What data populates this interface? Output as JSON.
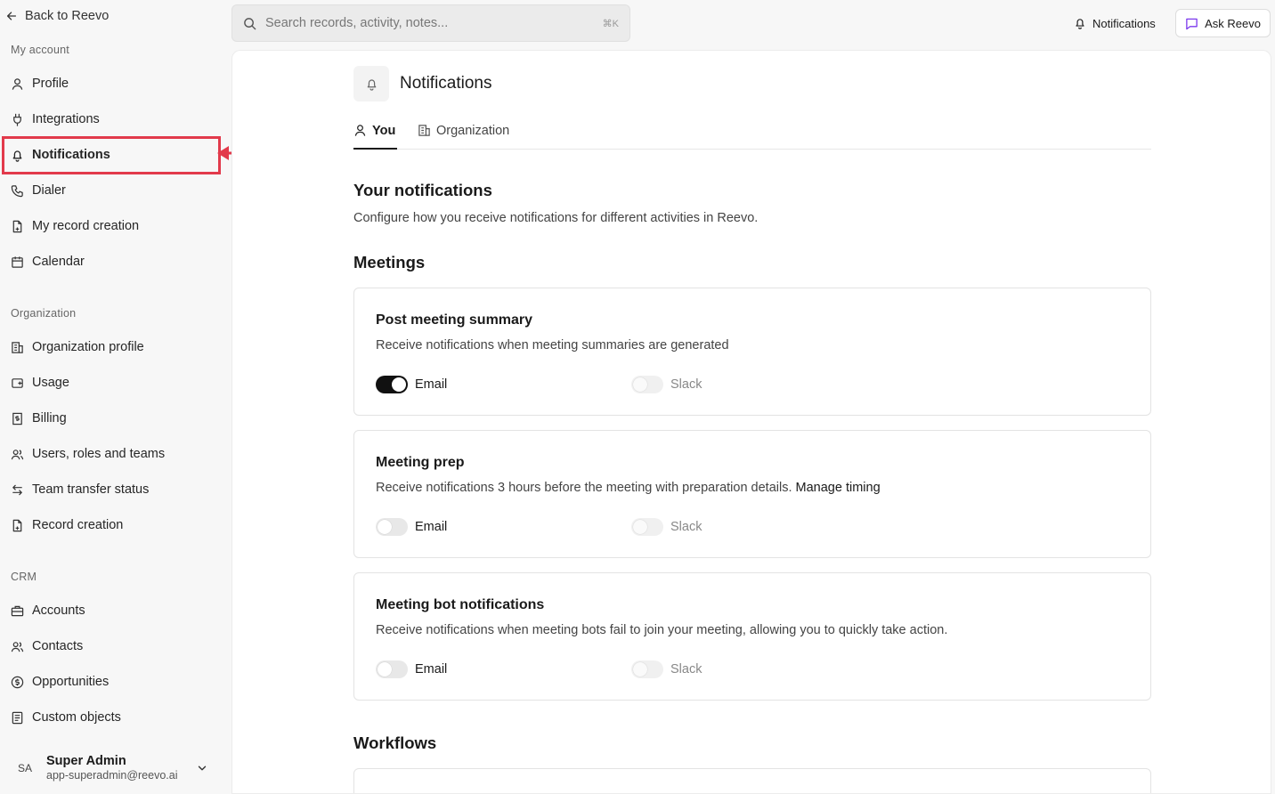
{
  "sidebar": {
    "back_label": "Back to Reevo",
    "my_account": {
      "label": "My account",
      "items": [
        {
          "label": "Profile",
          "icon": "user-icon"
        },
        {
          "label": "Integrations",
          "icon": "plug-icon"
        },
        {
          "label": "Notifications",
          "icon": "bell-icon",
          "active": true
        },
        {
          "label": "Dialer",
          "icon": "phone-icon"
        },
        {
          "label": "My record creation",
          "icon": "file-icon"
        },
        {
          "label": "Calendar",
          "icon": "calendar-icon"
        }
      ]
    },
    "organization": {
      "label": "Organization",
      "items": [
        {
          "label": "Organization profile",
          "icon": "building-icon"
        },
        {
          "label": "Usage",
          "icon": "usage-icon"
        },
        {
          "label": "Billing",
          "icon": "receipt-icon"
        },
        {
          "label": "Users, roles and teams",
          "icon": "users-icon"
        },
        {
          "label": "Team transfer status",
          "icon": "transfer-icon"
        },
        {
          "label": "Record creation",
          "icon": "file-icon"
        }
      ]
    },
    "crm": {
      "label": "CRM",
      "items": [
        {
          "label": "Accounts",
          "icon": "briefcase-icon"
        },
        {
          "label": "Contacts",
          "icon": "contacts-icon"
        },
        {
          "label": "Opportunities",
          "icon": "dollar-circle-icon"
        },
        {
          "label": "Custom objects",
          "icon": "doc-list-icon"
        }
      ]
    },
    "user": {
      "initials": "SA",
      "name": "Super Admin",
      "email": "app-superadmin@reevo.ai"
    }
  },
  "header": {
    "search_placeholder": "Search records, activity, notes...",
    "search_shortcut": "⌘K",
    "notifications_label": "Notifications",
    "ask_label": "Ask Reevo"
  },
  "main": {
    "title": "Notifications",
    "tabs": [
      {
        "label": "You",
        "active": true
      },
      {
        "label": "Organization",
        "active": false
      }
    ],
    "heading": "Your notifications",
    "description": "Configure how you receive notifications for different activities in Reevo.",
    "sections": [
      {
        "title": "Meetings",
        "cards": [
          {
            "title": "Post meeting summary",
            "description": "Receive notifications when meeting summaries are generated",
            "link": "",
            "email_label": "Email",
            "email_on": true,
            "slack_label": "Slack",
            "slack_enabled": false
          },
          {
            "title": "Meeting prep",
            "description": "Receive notifications 3 hours before the meeting with preparation details.",
            "link": "Manage timing",
            "email_label": "Email",
            "email_on": false,
            "slack_label": "Slack",
            "slack_enabled": false
          },
          {
            "title": "Meeting bot notifications",
            "description": "Receive notifications when meeting bots fail to join your meeting, allowing you to quickly take action.",
            "link": "",
            "email_label": "Email",
            "email_on": false,
            "slack_label": "Slack",
            "slack_enabled": false
          }
        ]
      },
      {
        "title": "Workflows",
        "cards": []
      }
    ]
  },
  "colors": {
    "highlight": "#e23a4b",
    "toggle_on": "#111111",
    "ask_icon": "#7c3aed"
  }
}
